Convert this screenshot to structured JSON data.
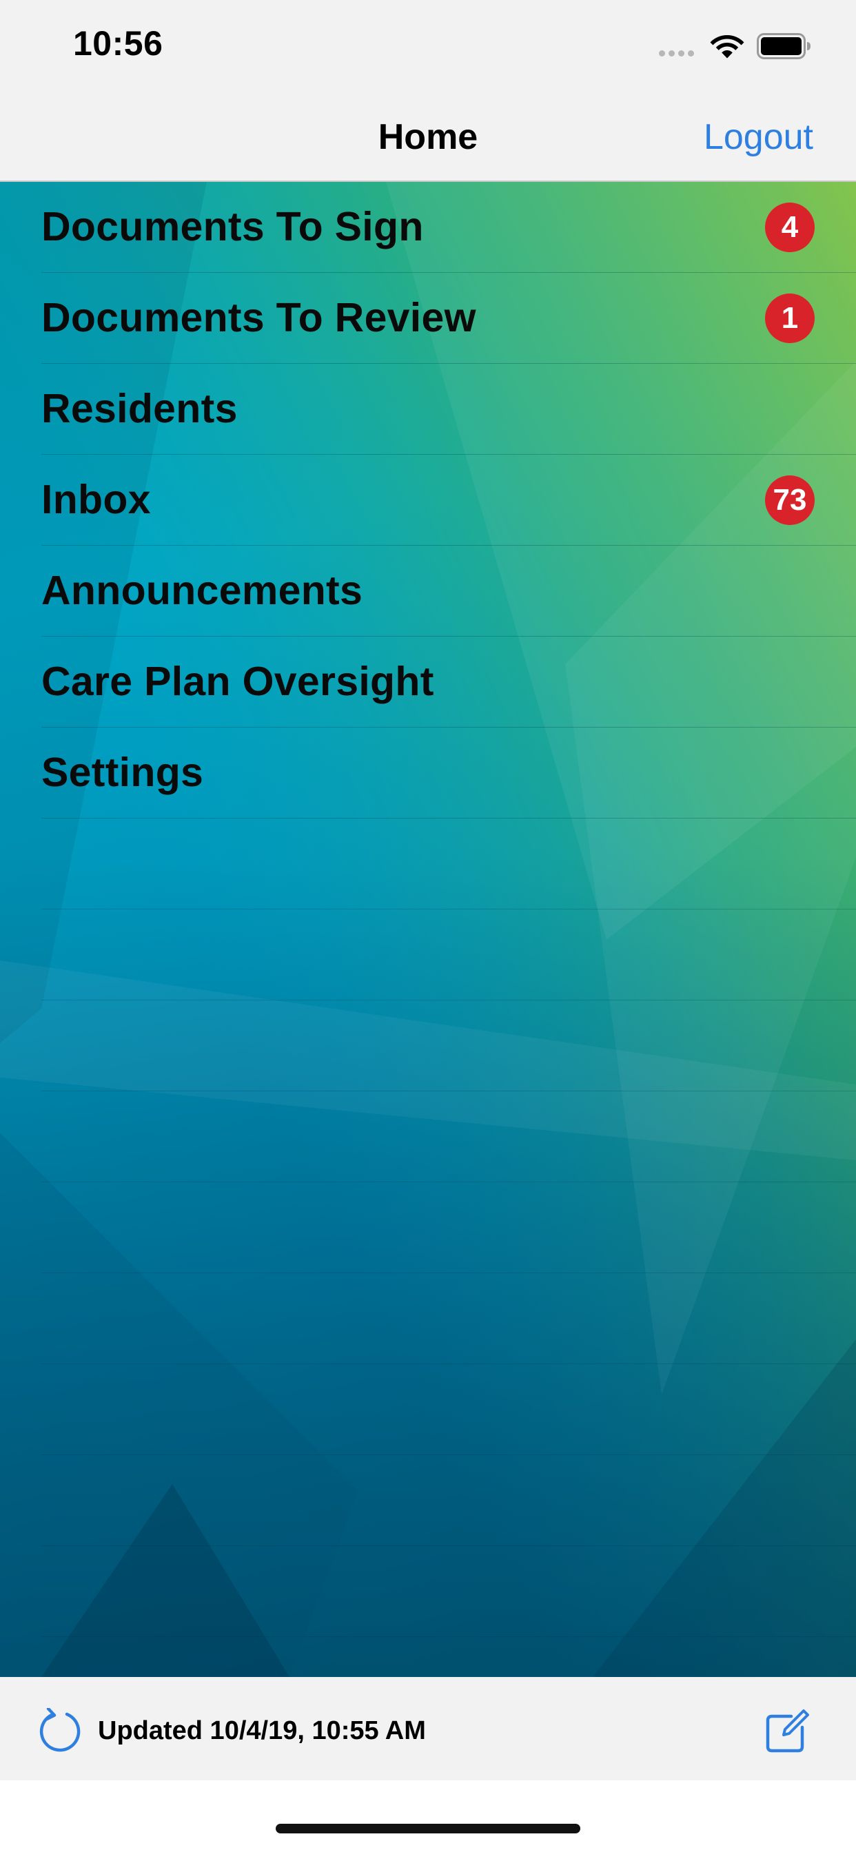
{
  "status_bar": {
    "time": "10:56"
  },
  "nav": {
    "title": "Home",
    "logout_label": "Logout"
  },
  "menu": {
    "items": [
      {
        "label": "Documents To Sign",
        "badge": "4"
      },
      {
        "label": "Documents To Review",
        "badge": "1"
      },
      {
        "label": "Residents",
        "badge": ""
      },
      {
        "label": "Inbox",
        "badge": "73"
      },
      {
        "label": "Announcements",
        "badge": ""
      },
      {
        "label": "Care Plan Oversight",
        "badge": ""
      },
      {
        "label": "Settings",
        "badge": ""
      }
    ]
  },
  "toolbar": {
    "updated_text": "Updated 10/4/19, 10:55 AM"
  },
  "colors": {
    "accent": "#2f7fe0",
    "badge": "#d9232b",
    "bar_background": "#f2f2f2"
  },
  "icons": {
    "wifi": "wifi-icon",
    "battery": "battery-icon",
    "refresh": "refresh-icon",
    "compose": "compose-icon"
  }
}
